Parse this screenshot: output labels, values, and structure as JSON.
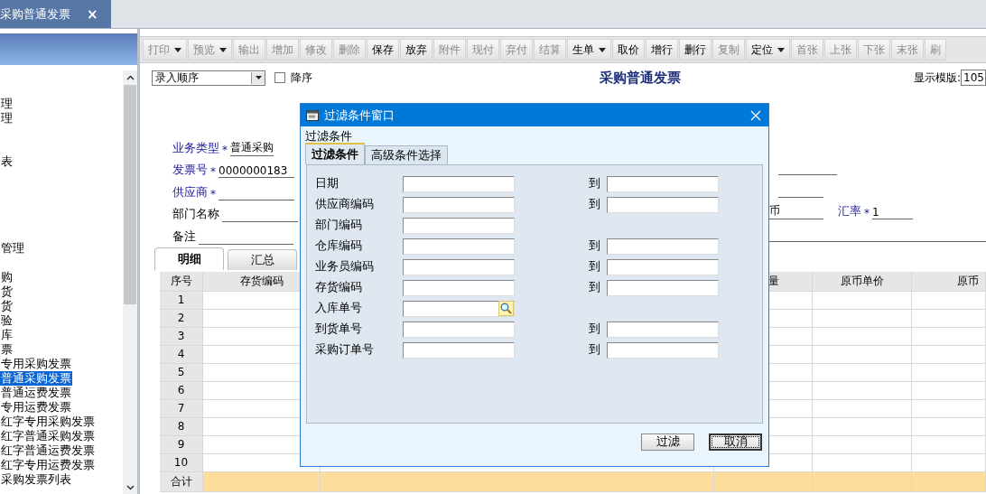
{
  "document_tab": {
    "title": "采购普通发票",
    "close": "×"
  },
  "sidebar": {
    "items": [
      {
        "label": "理",
        "selected": false
      },
      {
        "label": "理",
        "selected": false
      },
      {
        "label": "表",
        "selected": false
      },
      {
        "label": "管理",
        "selected": false
      },
      {
        "label": "购",
        "selected": false
      },
      {
        "label": "货",
        "selected": false
      },
      {
        "label": "货",
        "selected": false
      },
      {
        "label": "验",
        "selected": false
      },
      {
        "label": "库",
        "selected": false
      },
      {
        "label": "票",
        "selected": false
      },
      {
        "label": "专用采购发票",
        "selected": false
      },
      {
        "label": "普通采购发票",
        "selected": true
      },
      {
        "label": "普通运费发票",
        "selected": false
      },
      {
        "label": "专用运费发票",
        "selected": false
      },
      {
        "label": "红字专用采购发票",
        "selected": false
      },
      {
        "label": "红字普通采购发票",
        "selected": false
      },
      {
        "label": "红字普通运费发票",
        "selected": false
      },
      {
        "label": "红字专用运费发票",
        "selected": false
      },
      {
        "label": "采购发票列表",
        "selected": false
      }
    ]
  },
  "toolbar": [
    {
      "label": "打印",
      "disabled": true,
      "dropdown": true
    },
    {
      "label": "预览",
      "disabled": true,
      "dropdown": true
    },
    {
      "label": "输出",
      "disabled": true,
      "dropdown": false
    },
    {
      "label": "增加",
      "disabled": true,
      "dropdown": false
    },
    {
      "label": "修改",
      "disabled": true,
      "dropdown": false
    },
    {
      "label": "删除",
      "disabled": true,
      "dropdown": false
    },
    {
      "label": "保存",
      "disabled": false,
      "dropdown": false
    },
    {
      "label": "放弃",
      "disabled": false,
      "dropdown": false
    },
    {
      "label": "附件",
      "disabled": true,
      "dropdown": false
    },
    {
      "label": "现付",
      "disabled": true,
      "dropdown": false
    },
    {
      "label": "弃付",
      "disabled": true,
      "dropdown": false
    },
    {
      "label": "结算",
      "disabled": true,
      "dropdown": false
    },
    {
      "label": "生单",
      "disabled": false,
      "dropdown": true
    },
    {
      "label": "取价",
      "disabled": false,
      "dropdown": false
    },
    {
      "label": "增行",
      "disabled": false,
      "dropdown": false
    },
    {
      "label": "删行",
      "disabled": false,
      "dropdown": false
    },
    {
      "label": "复制",
      "disabled": true,
      "dropdown": false
    },
    {
      "label": "定位",
      "disabled": false,
      "dropdown": true
    },
    {
      "label": "首张",
      "disabled": true,
      "dropdown": false
    },
    {
      "label": "上张",
      "disabled": true,
      "dropdown": false
    },
    {
      "label": "下张",
      "disabled": true,
      "dropdown": false
    },
    {
      "label": "末张",
      "disabled": true,
      "dropdown": false
    },
    {
      "label": "刷",
      "disabled": true,
      "dropdown": false
    }
  ],
  "header": {
    "sort_select": "录入顺序",
    "descending": {
      "label": "降序",
      "checked": false
    },
    "title": "采购普通发票",
    "template_label": "显示模版:",
    "template_value": "105"
  },
  "fields": [
    {
      "label": "业务类型",
      "required": true,
      "required_mark": "*",
      "value": "普通采购"
    },
    {
      "label": "发票号",
      "required": true,
      "required_mark": "*",
      "value": "0000000183"
    },
    {
      "label": "供应商",
      "required": true,
      "required_mark": "*"
    },
    {
      "label": "部门名称",
      "required": false
    },
    {
      "label": "备注",
      "required": false
    }
  ],
  "right_fields": [
    {
      "value": "币"
    },
    {
      "label": "汇率",
      "required": true,
      "required_mark": "*",
      "value": "1"
    }
  ],
  "detail_tabs": [
    {
      "label": "明细",
      "selected": true
    },
    {
      "label": "汇总",
      "selected": false
    }
  ],
  "table": {
    "columns": [
      "序号",
      "存货编码",
      "量",
      "原币单价",
      "原币"
    ],
    "rows": [
      "1",
      "2",
      "3",
      "4",
      "5",
      "6",
      "7",
      "8",
      "9",
      "10"
    ],
    "total_label": "合计"
  },
  "dialog": {
    "title": "过滤条件窗口",
    "group_label": "过滤条件",
    "tabs": [
      {
        "label": "过滤条件",
        "selected": true
      },
      {
        "label": "高级条件选择",
        "selected": false
      }
    ],
    "rows": [
      {
        "label": "日期",
        "kind": "range",
        "to": "到"
      },
      {
        "label": "供应商编码",
        "kind": "range",
        "to": "到"
      },
      {
        "label": "部门编码",
        "kind": "single"
      },
      {
        "label": "仓库编码",
        "kind": "range",
        "to": "到"
      },
      {
        "label": "业务员编码",
        "kind": "range",
        "to": "到"
      },
      {
        "label": "存货编码",
        "kind": "range",
        "to": "到"
      },
      {
        "label": "入库单号",
        "kind": "lookup"
      },
      {
        "label": "到货单号",
        "kind": "range",
        "to": "到"
      },
      {
        "label": "采购订单号",
        "kind": "range",
        "to": "到"
      }
    ],
    "buttons": [
      {
        "label": "过滤",
        "focused": false
      },
      {
        "label": "取消",
        "focused": true
      }
    ]
  }
}
